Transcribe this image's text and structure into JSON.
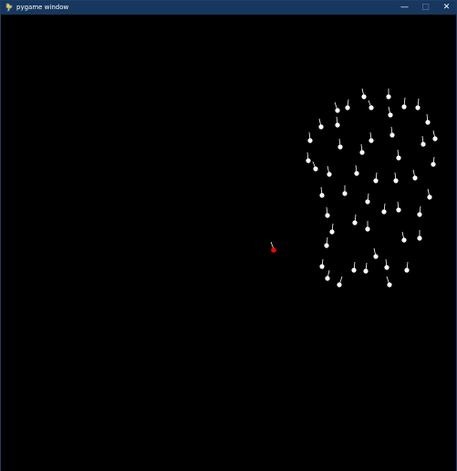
{
  "window": {
    "title": "pygame window",
    "controls": {
      "minimize": "—",
      "maximize": "□",
      "close": "✕"
    }
  },
  "game": {
    "background": "#000000",
    "player_color": "#ff0000",
    "enemy_color": "#ffffff",
    "enemy_count": 55
  }
}
